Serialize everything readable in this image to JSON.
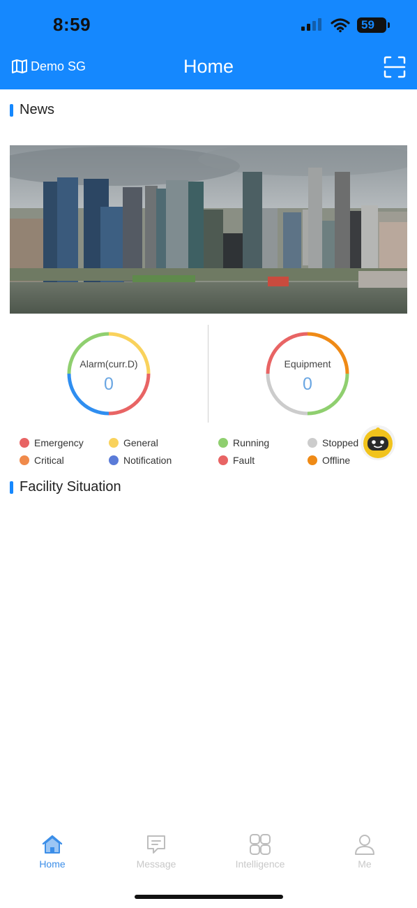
{
  "status_bar": {
    "time": "8:59",
    "battery": "59"
  },
  "nav": {
    "location": "Demo SG",
    "title": "Home"
  },
  "sections": {
    "news": "News",
    "facility": "Facility Situation"
  },
  "alarm": {
    "label": "Alarm(curr.D)",
    "value": "0",
    "legend": [
      {
        "label": "Emergency",
        "color": "#e86464"
      },
      {
        "label": "General",
        "color": "#f9d25c"
      },
      {
        "label": "Critical",
        "color": "#f08a4b"
      },
      {
        "label": "Notification",
        "color": "#5a7bd8"
      }
    ]
  },
  "equipment": {
    "label": "Equipment",
    "value": "0",
    "legend": [
      {
        "label": "Running",
        "color": "#8fcf6f"
      },
      {
        "label": "Stopped",
        "color": "#cccccc"
      },
      {
        "label": "Fault",
        "color": "#e86464"
      },
      {
        "label": "Offline",
        "color": "#ef8a16"
      }
    ]
  },
  "tabs": [
    {
      "label": "Home",
      "icon": "home-icon",
      "active": true
    },
    {
      "label": "Message",
      "icon": "message-icon",
      "active": false
    },
    {
      "label": "Intelligence",
      "icon": "intelligence-icon",
      "active": false
    },
    {
      "label": "Me",
      "icon": "user-icon",
      "active": false
    }
  ],
  "colors": {
    "primary": "#1588fe",
    "accent_text": "#3b8ee8"
  }
}
